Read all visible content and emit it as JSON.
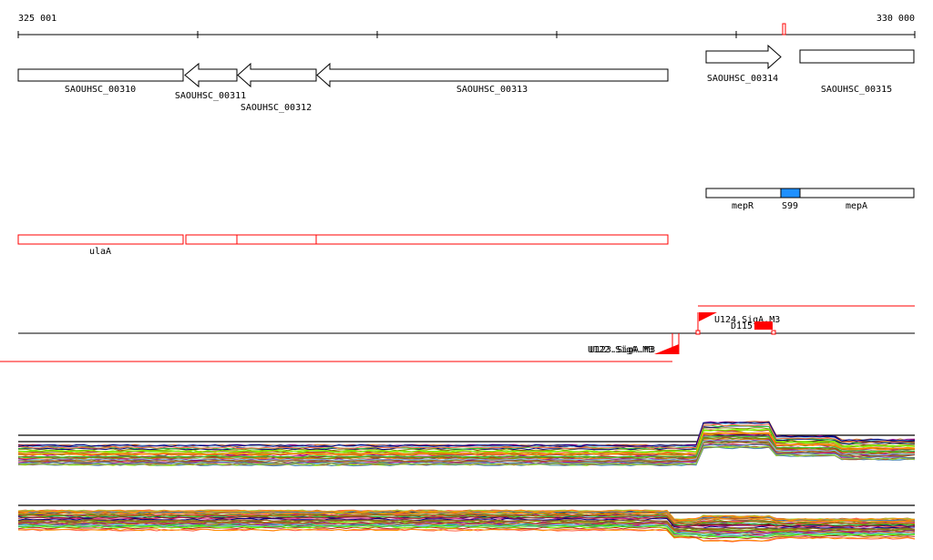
{
  "ruler": {
    "start_label": "325 001",
    "end_label": "330 000"
  },
  "genes": [
    {
      "label": "SAOUHSC_00310",
      "strand": "none"
    },
    {
      "label": "SAOUHSC_00311",
      "strand": "-"
    },
    {
      "label": "SAOUHSC_00312",
      "strand": "-"
    },
    {
      "label": "SAOUHSC_00313",
      "strand": "-"
    },
    {
      "label": "SAOUHSC_00314",
      "strand": "+"
    },
    {
      "label": "SAOUHSC_00315",
      "strand": "none"
    }
  ],
  "annotations": [
    {
      "label": "mepR"
    },
    {
      "label": "S99",
      "color": "#1e90ff"
    },
    {
      "label": "mepA"
    }
  ],
  "operon": {
    "label": "ulaA",
    "color": "#ff0000"
  },
  "promoters": [
    {
      "label": "U124.SigA.M3",
      "strand": "+"
    },
    {
      "label": "D115",
      "strand": "+"
    },
    {
      "label": "U122.SigA.M3",
      "strand": "-"
    },
    {
      "label": "U123.SigA.M3",
      "strand": "-"
    }
  ],
  "colors": {
    "feature": "#ff0000",
    "trace_palette": [
      "#d2691e",
      "#7cfc00",
      "#8b008b",
      "#87ceeb",
      "#ff6347",
      "#808000",
      "#000080",
      "#a0522d",
      "#32cd32",
      "#ff8c00",
      "#c71585",
      "#6b8e23",
      "#4682b4",
      "#b22222",
      "#9acd32"
    ]
  }
}
